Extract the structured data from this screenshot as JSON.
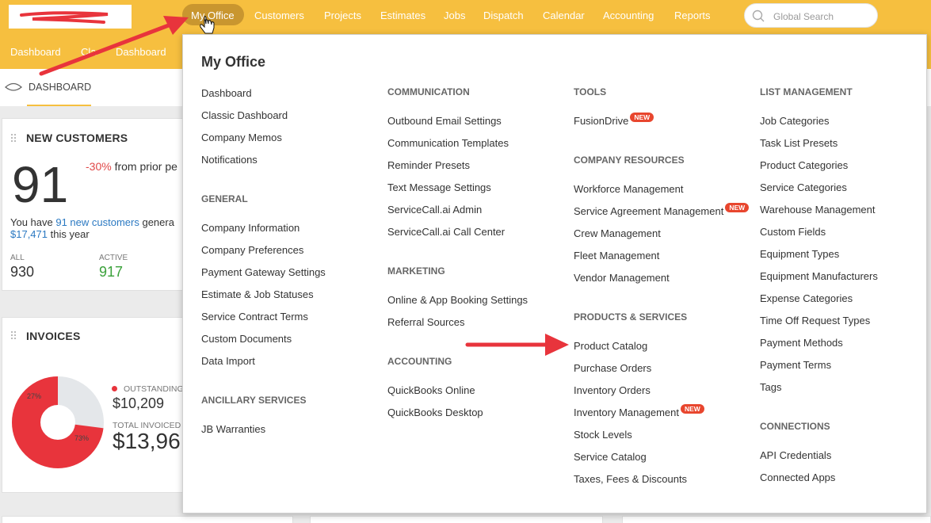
{
  "nav": {
    "items": [
      "My Office",
      "Customers",
      "Projects",
      "Estimates",
      "Jobs",
      "Dispatch",
      "Calendar",
      "Accounting",
      "Reports"
    ],
    "search_placeholder": "Global Search"
  },
  "subnav": {
    "items": [
      "Dashboard",
      "Cla",
      "Dashboard"
    ]
  },
  "tab": {
    "label": "DASHBOARD"
  },
  "new_customers": {
    "title": "NEW CUSTOMERS",
    "count": "91",
    "change": "-30%",
    "change_text": " from prior pe",
    "line1_pre": "You have ",
    "line1_link": "91 new customers",
    "line1_post": " genera",
    "line2_amount": "$17,471",
    "line2_post": " this year",
    "all_label": "ALL",
    "all_value": "930",
    "active_label": "ACTIVE",
    "active_value": "917"
  },
  "invoices": {
    "title": "INVOICES",
    "outstanding_label": "OUTSTANDING",
    "outstanding_value": "$10,209",
    "total_label": "TOTAL INVOICED",
    "total_value": "$13,96",
    "donut_small_pct": "27%",
    "donut_large_pct": "73%",
    "donut_fraction_red": 0.73,
    "colors": {
      "red": "#e8343c",
      "gray": "#e4e7ea"
    }
  },
  "menu": {
    "title": "My Office",
    "col1": {
      "items": [
        "Dashboard",
        "Classic Dashboard",
        "Company Memos",
        "Notifications"
      ],
      "general_heading": "GENERAL",
      "general_items": [
        "Company Information",
        "Company Preferences",
        "Payment Gateway Settings",
        "Estimate & Job Statuses",
        "Service Contract Terms",
        "Custom Documents",
        "Data Import"
      ],
      "ancillary_heading": "ANCILLARY SERVICES",
      "ancillary_items": [
        "JB Warranties"
      ]
    },
    "col2": {
      "communication_heading": "COMMUNICATION",
      "communication_items": [
        "Outbound Email Settings",
        "Communication Templates",
        "Reminder Presets",
        "Text Message Settings",
        "ServiceCall.ai Admin",
        "ServiceCall.ai Call Center"
      ],
      "marketing_heading": "MARKETING",
      "marketing_items": [
        "Online & App Booking Settings",
        "Referral Sources"
      ],
      "accounting_heading": "ACCOUNTING",
      "accounting_items": [
        "QuickBooks Online",
        "QuickBooks Desktop"
      ]
    },
    "col3": {
      "tools_heading": "TOOLS",
      "tools_items": [
        "FusionDrive"
      ],
      "resources_heading": "COMPANY RESOURCES",
      "resources_items": [
        "Workforce Management",
        "Service Agreement Management",
        "Crew Management",
        "Fleet Management",
        "Vendor Management"
      ],
      "products_heading": "PRODUCTS & SERVICES",
      "products_items": [
        "Product Catalog",
        "Purchase Orders",
        "Inventory Orders",
        "Inventory Management",
        "Stock Levels",
        "Service Catalog",
        "Taxes, Fees & Discounts"
      ]
    },
    "col4": {
      "list_heading": "LIST MANAGEMENT",
      "list_items": [
        "Job Categories",
        "Task List Presets",
        "Product Categories",
        "Service Categories",
        "Warehouse Management",
        "Custom Fields",
        "Equipment Types",
        "Equipment Manufacturers",
        "Expense Categories",
        "Time Off Request Types",
        "Payment Methods",
        "Payment Terms",
        "Tags"
      ],
      "connections_heading": "CONNECTIONS",
      "connections_items": [
        "API Credentials",
        "Connected Apps"
      ]
    },
    "badge_new": "NEW"
  },
  "colors": {
    "brand_yellow": "#f6bf3f",
    "pill": "#c9962f",
    "annotation_red": "#e8343c"
  }
}
